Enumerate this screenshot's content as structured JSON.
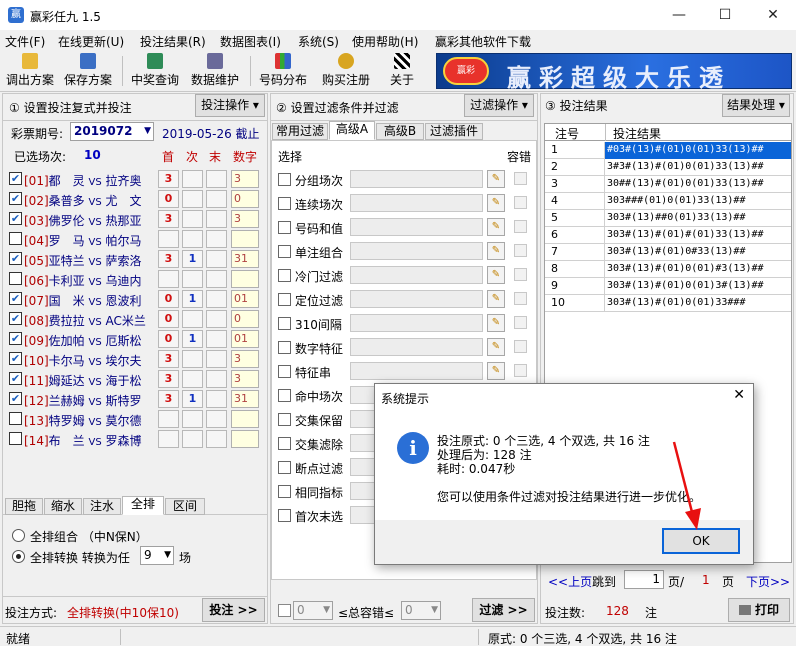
{
  "window": {
    "title": "赢彩任九 1.5",
    "controls": [
      "—",
      "☐",
      "✕"
    ]
  },
  "menu": [
    "文件(F)",
    "在线更新(U)",
    "投注结果(R)",
    "数据图表(I)",
    "系统(S)",
    "使用帮助(H)",
    "赢彩其他软件下载"
  ],
  "toolbar": {
    "buttons": [
      "调出方案",
      "保存方案",
      "中奖查询",
      "数据维护",
      "号码分布",
      "购买注册",
      "关于"
    ],
    "banner_logo": "赢彩",
    "banner_slogan": "赢彩超级大乐透"
  },
  "left_panel": {
    "header": "① 设置投注复式并投注",
    "action_button": "投注操作 ▾",
    "issue_label": "彩票期号:",
    "issue_value": "2019072",
    "deadline": "2019-05-26  截止",
    "selected_label": "已选场次:",
    "selected_count": "10",
    "col_headers": [
      "首",
      "次",
      "末",
      "数字"
    ],
    "matches": [
      {
        "num": "[01]",
        "home": "都　灵",
        "away": "拉齐奥",
        "checked": true,
        "first": "3",
        "second": "",
        "last": "",
        "digits": "3"
      },
      {
        "num": "[02]",
        "home": "桑普多",
        "away": "尤　文",
        "checked": true,
        "first": "0",
        "second": "",
        "last": "",
        "digits": "0"
      },
      {
        "num": "[03]",
        "home": "佛罗伦",
        "away": "热那亚",
        "checked": true,
        "first": "3",
        "second": "",
        "last": "",
        "digits": "3"
      },
      {
        "num": "[04]",
        "home": "罗　马",
        "away": "帕尔马",
        "checked": false,
        "first": "",
        "second": "",
        "last": "",
        "digits": ""
      },
      {
        "num": "[05]",
        "home": "亚特兰",
        "away": "萨索洛",
        "checked": true,
        "first": "3",
        "second": "1",
        "last": "",
        "digits": "31"
      },
      {
        "num": "[06]",
        "home": "卡利亚",
        "away": "乌迪内",
        "checked": false,
        "first": "",
        "second": "",
        "last": "",
        "digits": ""
      },
      {
        "num": "[07]",
        "home": "国　米",
        "away": "恩波利",
        "checked": true,
        "first": "0",
        "second": "1",
        "last": "",
        "digits": "01"
      },
      {
        "num": "[08]",
        "home": "费拉拉",
        "away": "AC米兰",
        "checked": true,
        "first": "0",
        "second": "",
        "last": "",
        "digits": "0"
      },
      {
        "num": "[09]",
        "home": "佐加帕",
        "away": "厄斯松",
        "checked": true,
        "first": "0",
        "second": "1",
        "last": "",
        "digits": "01"
      },
      {
        "num": "[10]",
        "home": "卡尔马",
        "away": "埃尔夫",
        "checked": true,
        "first": "3",
        "second": "",
        "last": "",
        "digits": "3"
      },
      {
        "num": "[11]",
        "home": "姆延达",
        "away": "海于松",
        "checked": true,
        "first": "3",
        "second": "",
        "last": "",
        "digits": "3"
      },
      {
        "num": "[12]",
        "home": "兰赫姆",
        "away": "斯特罗",
        "checked": true,
        "first": "3",
        "second": "1",
        "last": "",
        "digits": "31"
      },
      {
        "num": "[13]",
        "home": "特罗姆",
        "away": "莫尔德",
        "checked": false,
        "first": "",
        "second": "",
        "last": "",
        "digits": ""
      },
      {
        "num": "[14]",
        "home": "布　兰",
        "away": "罗森博",
        "checked": false,
        "first": "",
        "second": "",
        "last": "",
        "digits": ""
      }
    ],
    "vs": "VS",
    "tabs": [
      "胆拖",
      "缩水",
      "注水",
      "全排",
      "区间"
    ],
    "active_tab": "全排",
    "radio_full_combo": "全排组合  （中N保N）",
    "radio_full_convert": "全排转换  转换为任",
    "convert_value": "9",
    "convert_unit": "场",
    "bet_mode_label": "投注方式:",
    "bet_mode_value": "全排转换(中10保10)",
    "bet_button": "投注 >>"
  },
  "mid_panel": {
    "header": "② 设置过滤条件并过滤",
    "action_button": "过滤操作 ▾",
    "tabs": [
      "常用过滤",
      "高级A",
      "高级B",
      "过滤插件"
    ],
    "active_tab": "高级A",
    "col_select": "选择",
    "col_tolerance": "容错",
    "filters": [
      "分组场次",
      "连续场次",
      "号码和值",
      "单注组合",
      "冷门过滤",
      "定位过滤",
      "310间隔",
      "数字特征",
      "特征串",
      "命中场次",
      "交集保留",
      "交集滤除",
      "断点过滤",
      "相同指标",
      "首次末选"
    ],
    "tolerance_from": "0",
    "tolerance_label": "≤总容错≤",
    "tolerance_to": "0",
    "filter_button": "过滤 >>"
  },
  "right_panel": {
    "header": "③ 投注结果",
    "action_button": "结果处理 ▾",
    "col_no": "注号",
    "col_result": "投注结果",
    "results": [
      {
        "no": "1",
        "text": "#03#(13)#(01)0(01)33(13)##"
      },
      {
        "no": "2",
        "text": "3#3#(13)#(01)0(01)33(13)##"
      },
      {
        "no": "3",
        "text": "30##(13)#(01)0(01)33(13)##"
      },
      {
        "no": "4",
        "text": "303###(01)0(01)33(13)##"
      },
      {
        "no": "5",
        "text": "303#(13)##0(01)33(13)##"
      },
      {
        "no": "6",
        "text": "303#(13)#(01)#(01)33(13)##"
      },
      {
        "no": "7",
        "text": "303#(13)#(01)0#33(13)##"
      },
      {
        "no": "8",
        "text": "303#(13)#(01)0(01)#3(13)##"
      },
      {
        "no": "9",
        "text": "303#(13)#(01)0(01)3#(13)##"
      },
      {
        "no": "10",
        "text": "303#(13)#(01)0(01)33###"
      }
    ],
    "prev_page": "<<上页",
    "jump_to": "跳到",
    "page_value": "1",
    "page_sep": "页/",
    "page_total": "1",
    "page_unit": "页",
    "next_page": "下页>>",
    "count_label": "投注数:",
    "count_value": "128",
    "count_unit": "注",
    "print_button": "打印"
  },
  "dialog": {
    "title": "系统提示",
    "close": "✕",
    "lines": [
      "投注原式: 0 个三选, 4 个双选, 共 16 注",
      "处理后为: 128 注",
      "耗时: 0.047秒",
      "您可以使用条件过滤对投注结果进行进一步优化。"
    ],
    "ok": "OK"
  },
  "statusbar": {
    "left": "就绪",
    "right": "原式: 0 个三选, 4 个双选, 共 16 注"
  }
}
